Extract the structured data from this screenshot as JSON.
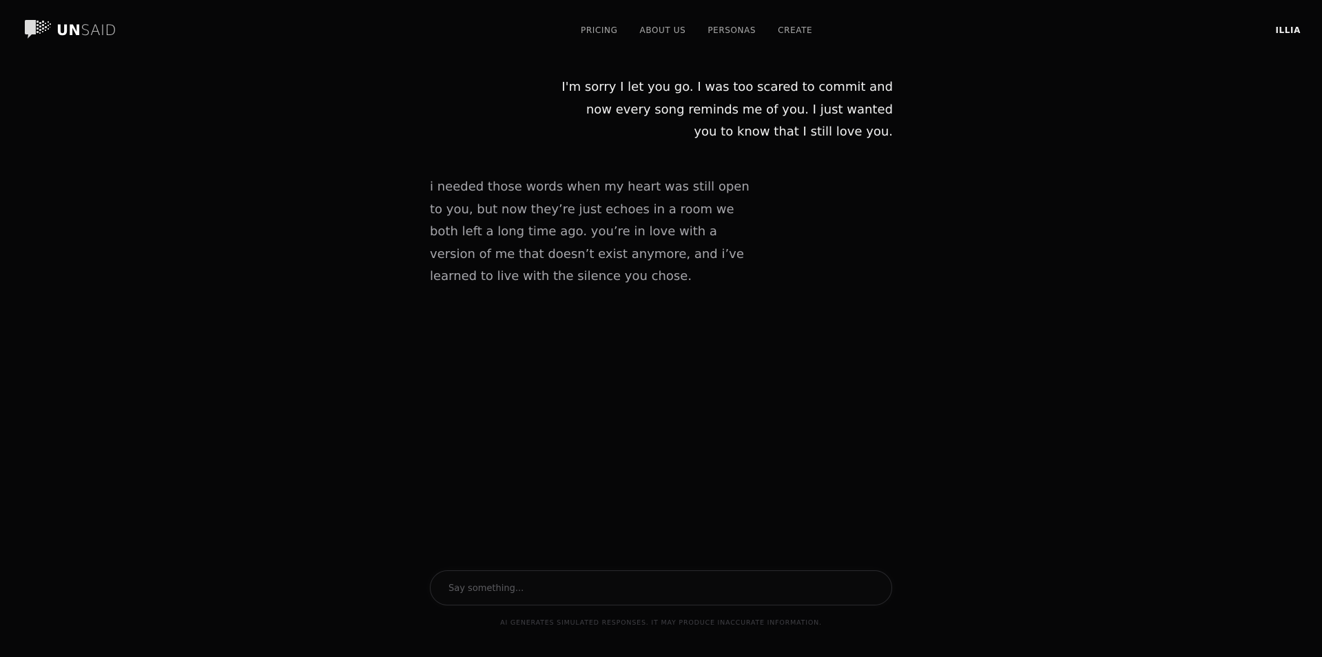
{
  "header": {
    "logo_strong": "UN",
    "logo_light": "SAID",
    "nav": [
      {
        "label": "PRICING"
      },
      {
        "label": "ABOUT US"
      },
      {
        "label": "PERSONAS"
      },
      {
        "label": "CREATE"
      }
    ],
    "user_name": "ILLIA"
  },
  "conversation": {
    "user_message": "I'm sorry I let you go. I was too scared to commit and now every song reminds me of you. I just wanted you to know that I still love you.",
    "persona_message": "i needed those words when my heart was still open to you, but now they’re just echoes in a room we both left a long time ago. you’re in love with a version of me that doesn’t exist anymore, and i’ve learned to live with the silence you chose."
  },
  "composer": {
    "placeholder": "Say something...",
    "value": ""
  },
  "footer": {
    "disclaimer": "AI GENERATES SIMULATED RESPONSES. IT MAY PRODUCE INACCURATE INFORMATION."
  },
  "colors": {
    "background": "#060607",
    "user_text": "#f2f2f2",
    "persona_text": "#a6a6ab",
    "nav_text": "#a9a9a9"
  },
  "icons": {
    "logo": "speech-bubble-pixelated-icon"
  }
}
